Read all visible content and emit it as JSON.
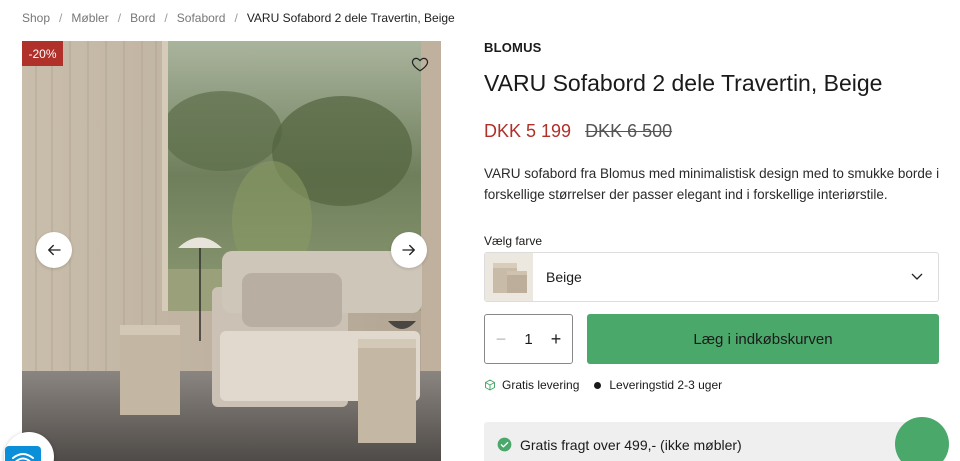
{
  "breadcrumb": {
    "items": [
      "Shop",
      "Møbler",
      "Bord",
      "Sofabord"
    ],
    "separator": "/",
    "current": "VARU Sofabord 2 dele Travertin, Beige"
  },
  "gallery": {
    "badge": "-20%",
    "badge_color": "#b0302a",
    "favorite_icon": "heart-icon",
    "prev_icon": "arrow-left-icon",
    "next_icon": "arrow-right-icon"
  },
  "product": {
    "brand": "BLOMUS",
    "title": "VARU Sofabord 2 dele Travertin, Beige",
    "price_sale": "DKK 5 199",
    "price_original": "DKK 6 500",
    "sale_color": "#b0302a",
    "description": "VARU sofabord fra Blomus med minimalistisk design med to smukke borde i forskellige størrelser der passer elegant ind i forskellige interiørstile."
  },
  "color_picker": {
    "label": "Vælg farve",
    "selected": "Beige",
    "chevron_icon": "chevron-down-icon"
  },
  "quantity": {
    "value": "1",
    "minus_icon": "minus-icon",
    "plus_icon": "plus-icon"
  },
  "cart": {
    "button_label": "Læg i indkøbskurven",
    "button_color": "#4aa86b"
  },
  "shipping": {
    "free_delivery": "Gratis levering",
    "delivery_time": "Leveringstid 2-3 uger"
  },
  "banner": {
    "text": "Gratis fragt over 499,- (ikke møbler)"
  }
}
